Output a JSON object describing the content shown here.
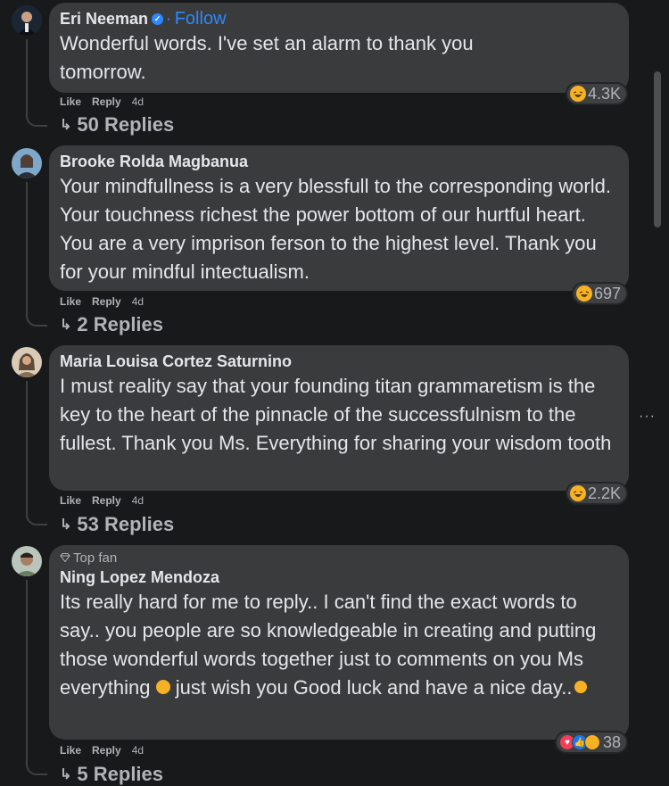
{
  "comments": [
    {
      "name": "Eri Neeman",
      "verified": true,
      "follow_label": "Follow",
      "text": "Wonderful words. I've set an alarm to thank you tomorrow.",
      "like_label": "Like",
      "reply_label": "Reply",
      "time": "4d",
      "reaction_count": "4.3K",
      "replies_label": "50 Replies"
    },
    {
      "name": "Brooke Rolda Magbanua",
      "text": "Your mindfullness is a very blessfull to the corresponding world. Your touchness richest the power bottom of our hurtful heart. You are a very imprison ferson to the highest level. Thank you for your mindful intectualism.",
      "like_label": "Like",
      "reply_label": "Reply",
      "time": "4d",
      "reaction_count": "697",
      "replies_label": "2 Replies"
    },
    {
      "name": "Maria Louisa Cortez Saturnino",
      "text": "I must reality say that your founding titan grammaretism is the key to the heart of the pinnacle of the successfulnism to the fullest. Thank you Ms. Everything for sharing your wisdom tooth",
      "like_label": "Like",
      "reply_label": "Reply",
      "time": "4d",
      "reaction_count": "2.2K",
      "replies_label": "53 Replies"
    },
    {
      "badge": "Top fan",
      "name": "Ning Lopez Mendoza",
      "text_part1": "Its really hard for me to reply.. I can't find the exact words to say.. you people are so knowledgeable in creating and putting those wonderful words together just to comments on you Ms everything",
      "text_part2": " just wish you Good luck and have a nice day..",
      "like_label": "Like",
      "reply_label": "Reply",
      "time": "4d",
      "reaction_count": "38",
      "replies_label": "5 Replies"
    }
  ],
  "icons": {
    "reaction_haha": "haha-emoji-icon",
    "reaction_love": "heart-icon",
    "reaction_like": "thumbs-up-icon",
    "reaction_care": "care-emoji-icon",
    "reply_arrow": "reply-arrow-icon",
    "more": "more-options-icon",
    "verified": "verified-badge-icon",
    "top_fan": "diamond-icon"
  },
  "colors": {
    "background": "#18191a",
    "bubble": "#3a3b3c",
    "accent": "#2d88ff",
    "secondary_text": "#b0b3b8"
  }
}
